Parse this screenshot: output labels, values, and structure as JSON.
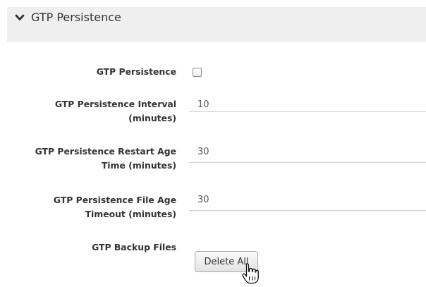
{
  "panel": {
    "title": "GTP Persistence",
    "chevron_icon": "chevron-down-icon"
  },
  "form": {
    "gtp_persistence": {
      "label": "GTP Persistence",
      "checked": false
    },
    "interval": {
      "label_line1": "GTP Persistence Interval",
      "label_line2": "(minutes)",
      "value": "10"
    },
    "restart_age": {
      "label_line1": "GTP Persistence Restart Age",
      "label_line2": "Time (minutes)",
      "value": "30"
    },
    "file_age": {
      "label_line1": "GTP Persistence File Age",
      "label_line2": "Timeout (minutes)",
      "value": "30"
    },
    "backup_files": {
      "label": "GTP Backup Files",
      "button_label": "Delete All"
    }
  },
  "cursor_icon": "hand-pointer-icon"
}
